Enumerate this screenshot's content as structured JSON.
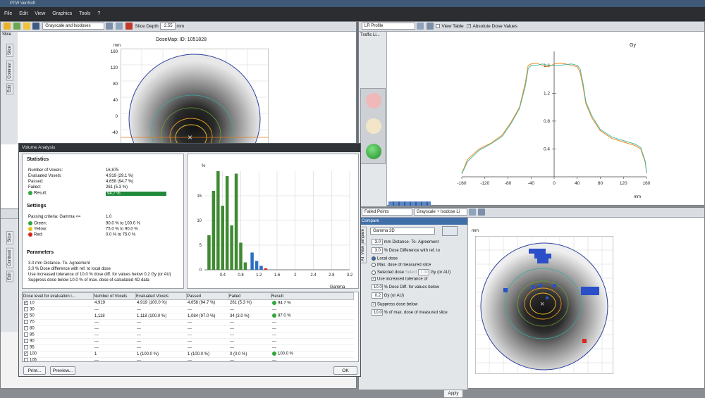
{
  "app": {
    "title": "PTW VeriSoft"
  },
  "menu": [
    "File",
    "Edit",
    "View",
    "Graphics",
    "Tools",
    "?"
  ],
  "toolbar_left": {
    "display_mode": "Grayscale and Isodoses",
    "slice_depth_label": "Slice Depth",
    "slice_depth_value": "2.55",
    "slice_depth_unit": "mm"
  },
  "left_tabs": [
    "Slice",
    "Slice",
    "Contrast",
    "Edit"
  ],
  "dosemap": {
    "title": "DoseMap: ID: 1051828",
    "unit": "mm",
    "y_ticks": [
      "160",
      "120",
      "80",
      "40",
      "0",
      "-40"
    ]
  },
  "profile_toolbar": {
    "profile": "LR Profile",
    "view_table": "View Table",
    "absolute_dose": "Absolute Dose Values"
  },
  "traffic": {
    "title": "Traffic Li..."
  },
  "profile_chart": {
    "ylabel": "Gy",
    "xunit": "mm"
  },
  "compare_toolbar": {
    "mode": "Failed Points",
    "display": "Grayscale + Isodose Li"
  },
  "compare": {
    "title": "Compare",
    "tabs": [
      "Compare",
      "AT View"
    ],
    "method": "Gamma 3D",
    "dta_value": "3.0",
    "dta_label": "mm Distance- To- Agreement",
    "dd_value": "3.0",
    "dd_label": "% Dose Difference with ref. to",
    "opt_local": "Local dose",
    "opt_max": "Max. dose of measured slice",
    "opt_selected": "Selected dose",
    "opt_selected_btn": "Select",
    "opt_selected_val": "1.00",
    "opt_selected_unit": "Gy (or AU)",
    "tol_label": "Use increased tolerance of",
    "tol_value": "10.0",
    "tol_text": "% Dose Diff. for values below",
    "tol_dose": "0.2",
    "tol_unit": "Gy (or AU)",
    "sup_label": "Suppress dose below",
    "sup_value": "10.0",
    "sup_text": "% of max. dose of measured slice",
    "apply": "Apply"
  },
  "compare_map": {
    "unit": "mm"
  },
  "volume": {
    "title": "Volume Analysis",
    "stats_heading": "Statistics",
    "stats": [
      {
        "label": "Number of Voxels:",
        "value": "16,875"
      },
      {
        "label": "Evaluated Voxels:",
        "value": "4,919 (29.1 %)"
      },
      {
        "label": "Passed:",
        "value": "4,658 (94.7 %)"
      },
      {
        "label": "Failed:",
        "value": "261 (5.3 %)"
      },
      {
        "label": "Result:",
        "value": "94.7 %"
      }
    ],
    "settings_heading": "Settings",
    "passing": {
      "label": "Passing criteria: Gamma <=",
      "value": "1.0"
    },
    "levels": [
      {
        "label": "Green:",
        "value": "90.0 % to 100.0 %",
        "color": "#2fa83a"
      },
      {
        "label": "Yellow:",
        "value": "75.0 % to 90.0 %",
        "color": "#e3c21a"
      },
      {
        "label": "Red:",
        "value": "0.0 % to 75.0 %",
        "color": "#d6281e"
      }
    ],
    "params_heading": "Parameters",
    "params": [
      "3.0 mm Distance- To- Agreement",
      "3.0 % Dose difference with ref. to local dose",
      "Use increased tolerance of 10.0 % dose diff. for values below 0.2 Gy (or AU)",
      "Suppress dose below 10.0 % of max. dose of calculated 4D data"
    ],
    "table_headers": [
      "Dose level for evaluation i...",
      "Number of Voxels",
      "Evaluated Voxels",
      "Passed",
      "Failed",
      "Result"
    ],
    "rows": [
      {
        "level": "10",
        "checked": true,
        "voxels": "4,919",
        "evaluated": "4,919 (100.0 %)",
        "passed": "4,658 (94.7 %)",
        "failed": "261 (5.3 %)",
        "result": "94.7 %"
      },
      {
        "level": "30",
        "checked": false,
        "voxels": "---",
        "evaluated": "---",
        "passed": "---",
        "failed": "---",
        "result": "---"
      },
      {
        "level": "50",
        "checked": true,
        "voxels": "1,118",
        "evaluated": "1,118 (100.0 %)",
        "passed": "1,084 (97.0 %)",
        "failed": "34 (3.0 %)",
        "result": "97.0 %"
      },
      {
        "level": "70",
        "checked": false,
        "voxels": "---",
        "evaluated": "---",
        "passed": "---",
        "failed": "---",
        "result": "---"
      },
      {
        "level": "80",
        "checked": false,
        "voxels": "---",
        "evaluated": "---",
        "passed": "---",
        "failed": "---",
        "result": "---"
      },
      {
        "level": "85",
        "checked": false,
        "voxels": "---",
        "evaluated": "---",
        "passed": "---",
        "failed": "---",
        "result": "---"
      },
      {
        "level": "90",
        "checked": false,
        "voxels": "---",
        "evaluated": "---",
        "passed": "---",
        "failed": "---",
        "result": "---"
      },
      {
        "level": "95",
        "checked": false,
        "voxels": "---",
        "evaluated": "---",
        "passed": "---",
        "failed": "---",
        "result": "---"
      },
      {
        "level": "100",
        "checked": true,
        "voxels": "1",
        "evaluated": "1 (100.0 %)",
        "passed": "1 (100.0 %)",
        "failed": "0 (0.0 %)",
        "result": "100.0 %"
      },
      {
        "level": "105",
        "checked": false,
        "voxels": "---",
        "evaluated": "---",
        "passed": "---",
        "failed": "---",
        "result": "---"
      }
    ],
    "buttons": {
      "print": "Print...",
      "preview": "Preview...",
      "ok": "OK"
    }
  },
  "histogram": {
    "ylabel": "%",
    "xlabel": "Gamma"
  },
  "chart_data": [
    {
      "type": "bar",
      "title": "",
      "ylabel": "%",
      "xlabel": "Gamma",
      "ylim": [
        0,
        20
      ],
      "xlim": [
        0,
        3.2
      ],
      "yticks": [
        0,
        5,
        10,
        15
      ],
      "xticks": [
        0.4,
        0.8,
        1.2,
        1.6,
        2,
        2.4,
        2.8,
        3.2
      ],
      "x": [
        0.1,
        0.2,
        0.3,
        0.4,
        0.5,
        0.6,
        0.7,
        0.8,
        0.9,
        1.05,
        1.15,
        1.25,
        1.35
      ],
      "values": [
        7,
        16,
        20,
        13,
        19,
        9,
        19.5,
        5.5,
        1.5,
        3.5,
        1.8,
        0.8,
        0.3
      ],
      "colors": [
        "#3f8a32",
        "#3f8a32",
        "#3f8a32",
        "#3f8a32",
        "#3f8a32",
        "#3f8a32",
        "#3f8a32",
        "#3f8a32",
        "#3f8a32",
        "#2b6fc2",
        "#2b6fc2",
        "#2b6fc2",
        "#d6281e"
      ]
    },
    {
      "type": "line",
      "title": "",
      "ylabel": "Gy",
      "xlabel": "mm",
      "xlim": [
        -160,
        160
      ],
      "ylim": [
        0,
        1.8
      ],
      "xticks": [
        -160,
        -120,
        -80,
        -40,
        0,
        40,
        80,
        120,
        160
      ],
      "yticks": [
        0.4,
        0.8,
        1.2,
        1.6
      ],
      "series": [
        {
          "color": "#f08a1c",
          "x": [
            -160,
            -150,
            -130,
            -110,
            -90,
            -75,
            -60,
            -50,
            -45,
            -40,
            -30,
            -20,
            -10,
            0,
            10,
            20,
            30,
            40,
            45,
            50,
            55,
            65,
            80,
            100,
            120,
            140,
            150,
            158,
            160
          ],
          "y": [
            0.05,
            0.25,
            0.4,
            0.48,
            0.6,
            0.78,
            1.0,
            1.35,
            1.6,
            1.62,
            1.63,
            1.6,
            1.58,
            1.62,
            1.63,
            1.62,
            1.6,
            1.58,
            1.5,
            1.3,
            1.05,
            0.85,
            0.66,
            0.55,
            0.5,
            0.45,
            0.4,
            0.2,
            0.05
          ]
        },
        {
          "color": "#49b8a8",
          "x": [
            -160,
            -150,
            -130,
            -110,
            -90,
            -75,
            -60,
            -50,
            -45,
            -40,
            -30,
            -20,
            -10,
            0,
            10,
            20,
            30,
            40,
            45,
            50,
            55,
            65,
            80,
            100,
            120,
            140,
            150,
            158,
            160
          ],
          "y": [
            0.04,
            0.22,
            0.38,
            0.47,
            0.58,
            0.76,
            0.98,
            1.3,
            1.55,
            1.6,
            1.6,
            1.62,
            1.6,
            1.6,
            1.6,
            1.61,
            1.62,
            1.6,
            1.55,
            1.35,
            1.08,
            0.88,
            0.68,
            0.57,
            0.52,
            0.47,
            0.42,
            0.22,
            0.05
          ]
        }
      ]
    }
  ]
}
